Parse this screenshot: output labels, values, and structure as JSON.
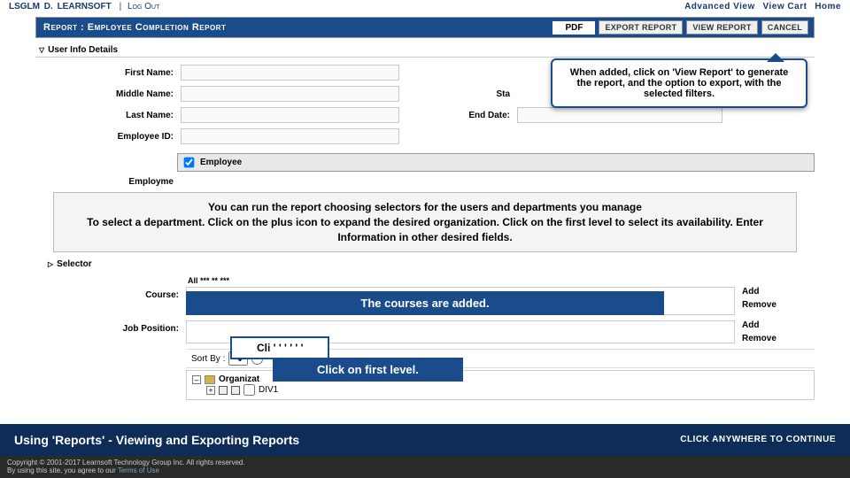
{
  "topbar": {
    "brand1": "LSGLM",
    "dot": "D.",
    "brand2": "LEARNSOFT",
    "sep": "|",
    "logout": "Log Out",
    "adv": "Advanced View",
    "cart": "View Cart",
    "home": "Home"
  },
  "header": {
    "title": "Report : Employee Completion Report",
    "format": "PDF",
    "export": "EXPORT REPORT",
    "view": "VIEW REPORT",
    "cancel": "CANCEL"
  },
  "section1": {
    "title": "User Info Details"
  },
  "labels": {
    "first": "First Name:",
    "middle": "Middle Name:",
    "last": "Last Name:",
    "emp": "Employee ID:",
    "sta": "Sta",
    "end": "End Date:",
    "employme": "Employme",
    "checkbox": "Employee",
    "course": "Course:",
    "job": "Job Position:",
    "sortby": "Sort By :",
    "selector": "Selector"
  },
  "callouts": {
    "c1": "When added, click on 'View Report' to generate the report, and the option to export, with the selected filters.",
    "c2": "You can run the report choosing selectors for the users and departments you manage\nTo select a department. Click on the plus icon to expand the desired organization. Click on the first level to select its availability. Enter Information in other desired fields.",
    "courses": "The courses are added.",
    "plus": "Cli ' ' ' ' ' '",
    "first": "Click on first level."
  },
  "side": {
    "add": "Add",
    "remove": "Remove"
  },
  "tree": {
    "root": "Organizat",
    "child": "DIV1",
    "attr": "All *** ** ***"
  },
  "footer": {
    "title": "Using 'Reports' - Viewing and Exporting Reports",
    "cont": "CLICK ANYWHERE TO CONTINUE",
    "legal1": "Copyright © 2001-2017 Learnsoft Technology Group Inc. All rights reserved.",
    "legal2": "By using this site, you agree to our ",
    "tou": "Terms of Use"
  }
}
